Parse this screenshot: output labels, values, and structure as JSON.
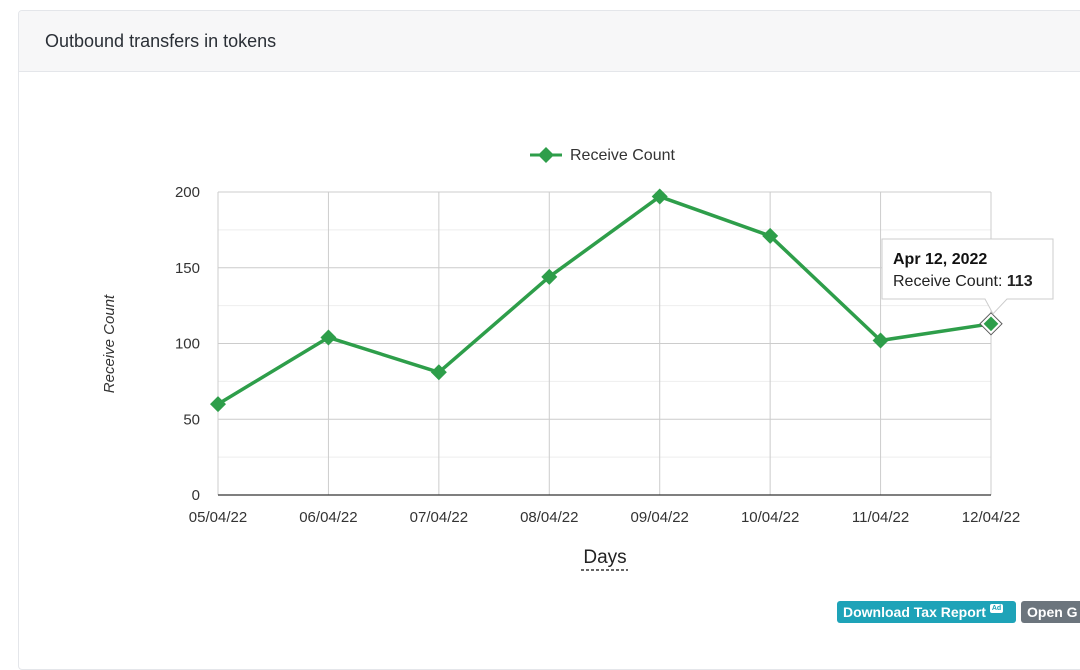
{
  "card": {
    "title": "Outbound transfers in tokens"
  },
  "chart_data": {
    "type": "line",
    "title": "",
    "xlabel": "Days",
    "ylabel": "Receive Count",
    "categories": [
      "05/04/22",
      "06/04/22",
      "07/04/22",
      "08/04/22",
      "09/04/22",
      "10/04/22",
      "11/04/22",
      "12/04/22"
    ],
    "series": [
      {
        "name": "Receive Count",
        "color": "#2e9e4a",
        "values": [
          60,
          104,
          81,
          144,
          197,
          171,
          102,
          113
        ]
      }
    ],
    "ylim": [
      0,
      200
    ],
    "yticks": [
      0,
      50,
      100,
      150,
      200
    ],
    "grid": true,
    "legend": "top-center",
    "tooltip": {
      "date": "Apr 12, 2022",
      "series": "Receive Count",
      "value": "113",
      "index": 7
    }
  },
  "buttons": {
    "download_tax_report": "Download Tax Report",
    "ad_badge": "Ad",
    "open": "Open G"
  }
}
